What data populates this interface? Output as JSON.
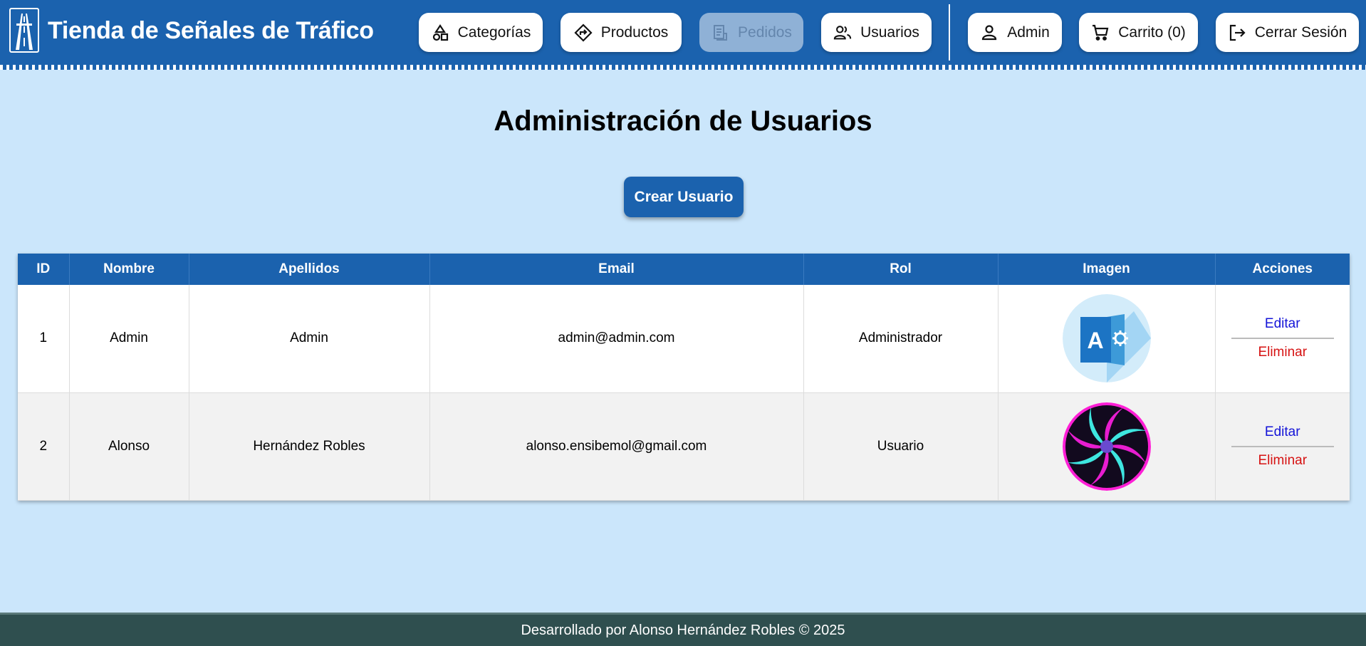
{
  "brand": {
    "title": "Tienda de Señales de Tráfico",
    "logo_icon": "highway-icon"
  },
  "nav": {
    "categorias": "Categorías",
    "productos": "Productos",
    "pedidos": "Pedidos",
    "usuarios": "Usuarios",
    "admin": "Admin",
    "carrito": "Carrito (0)",
    "cerrar_sesion": "Cerrar Sesión"
  },
  "page": {
    "title": "Administración de Usuarios",
    "create_button": "Crear Usuario"
  },
  "table": {
    "headers": [
      "ID",
      "Nombre",
      "Apellidos",
      "Email",
      "Rol",
      "Imagen",
      "Acciones"
    ],
    "rows": [
      {
        "id": "1",
        "nombre": "Admin",
        "apellidos": "Admin",
        "email": "admin@admin.com",
        "rol": "Administrador",
        "imagen": "admin-avatar-icon",
        "editar": "Editar",
        "eliminar": "Eliminar"
      },
      {
        "id": "2",
        "nombre": "Alonso",
        "apellidos": "Hernández Robles",
        "email": "alonso.ensibemol@gmail.com",
        "rol": "Usuario",
        "imagen": "spiral-avatar-icon",
        "editar": "Editar",
        "eliminar": "Eliminar"
      }
    ]
  },
  "footer": {
    "text": "Desarrollado por Alonso Hernández Robles © 2025"
  },
  "colors": {
    "primary": "#1b62ae",
    "background": "#cbe6fb",
    "footer": "#2f4f4f",
    "edit_link": "#1414d8",
    "delete_link": "#d61212"
  }
}
